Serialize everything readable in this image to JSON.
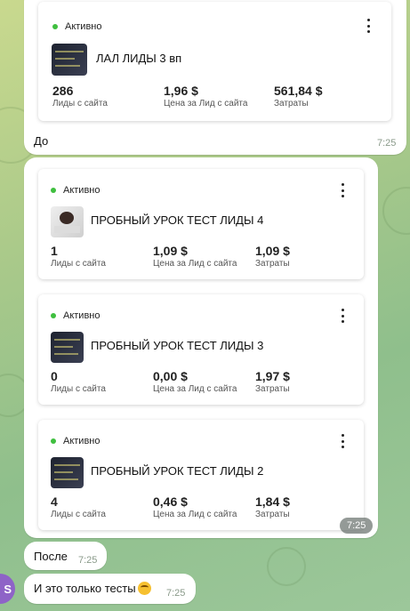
{
  "messages": [
    {
      "cards": [
        {
          "status": "Активно",
          "name": "ЛАЛ ЛИДЫ 3 вп",
          "thumb": "dark-creative",
          "metrics": [
            {
              "value": "286",
              "label": "Лиды с сайта"
            },
            {
              "value": "1,96 $",
              "label": "Цена за Лид с сайта"
            },
            {
              "value": "561,84 $",
              "label": "Затраты"
            }
          ]
        }
      ],
      "caption": "До",
      "time": "7:25"
    },
    {
      "cards": [
        {
          "status": "Активно",
          "name": "ПРОБНЫЙ УРОК ТЕСТ ЛИДЫ 4",
          "thumb": "photo",
          "metrics": [
            {
              "value": "1",
              "label": "Лиды с сайта"
            },
            {
              "value": "1,09 $",
              "label": "Цена за Лид с сайта"
            },
            {
              "value": "1,09 $",
              "label": "Затраты"
            }
          ]
        },
        {
          "status": "Активно",
          "name": "ПРОБНЫЙ УРОК ТЕСТ ЛИДЫ 3",
          "thumb": "dark-creative",
          "metrics": [
            {
              "value": "0",
              "label": "Лиды с сайта"
            },
            {
              "value": "0,00 $",
              "label": "Цена за Лид с сайта"
            },
            {
              "value": "1,97 $",
              "label": "Затраты"
            }
          ]
        },
        {
          "status": "Активно",
          "name": "ПРОБНЫЙ УРОК ТЕСТ ЛИДЫ 2",
          "thumb": "dark-creative",
          "metrics": [
            {
              "value": "4",
              "label": "Лиды с сайта"
            },
            {
              "value": "0,46 $",
              "label": "Цена за Лид с сайта"
            },
            {
              "value": "1,84 $",
              "label": "Затраты"
            }
          ]
        }
      ],
      "time": "7:25"
    },
    {
      "text": "После",
      "time": "7:25"
    },
    {
      "text": "И это только тесты",
      "emoji": "star-struck-emoji",
      "time": "7:25",
      "avatar_initial": "S"
    }
  ],
  "colors": {
    "active_dot": "#3fbf3f",
    "bubble": "#ffffff",
    "avatar": "#8e63c7"
  }
}
